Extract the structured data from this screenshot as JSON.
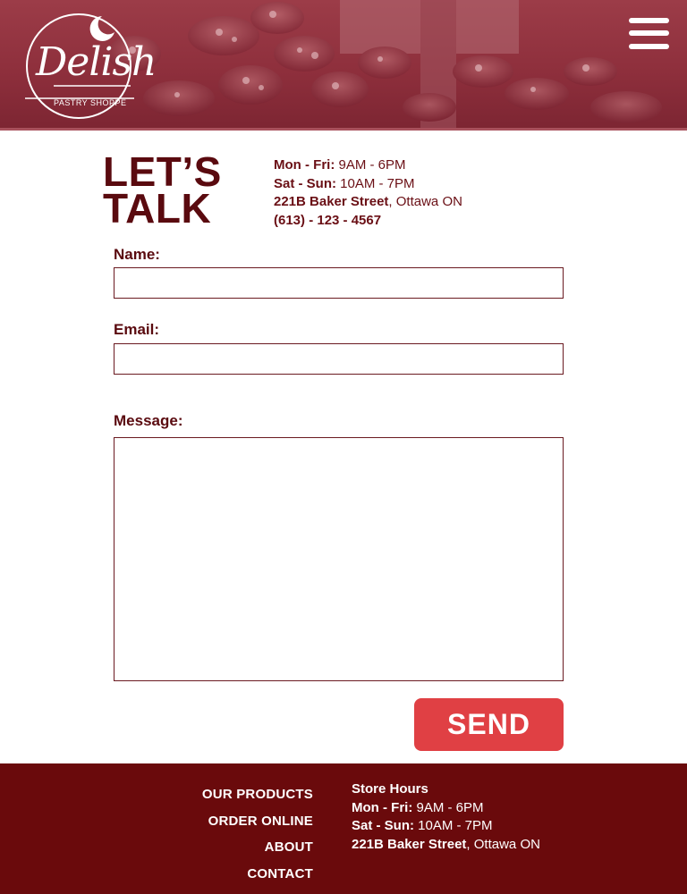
{
  "header": {
    "logo": {
      "name": "Delish",
      "tagline": "PASTRY SHOPPE"
    },
    "menu_icon": "hamburger-menu-icon"
  },
  "contact": {
    "heading_line1": "LET’S",
    "heading_line2": "TALK",
    "weekday_label": "Mon - Fri:",
    "weekday_hours": " 9AM - 6PM",
    "weekend_label": "Sat - Sun:",
    "weekend_hours": " 10AM - 7PM",
    "street": "221B Baker Street",
    "city": ", Ottawa ON",
    "phone_area": "(613)",
    "phone_number": " - 123 - 4567"
  },
  "form": {
    "name_label": "Name:",
    "name_value": "",
    "email_label": "Email:",
    "email_value": "",
    "message_label": "Message:",
    "message_value": "",
    "send_label": "SEND"
  },
  "footer": {
    "nav": [
      "OUR PRODUCTS",
      "ORDER ONLINE",
      "ABOUT",
      "CONTACT"
    ],
    "hours_title": "Store Hours",
    "weekday_label": "Mon - Fri:",
    "weekday_hours": " 9AM - 6PM",
    "weekend_label": "Sat - Sun:",
    "weekend_hours": " 10AM - 7PM",
    "street": "221B Baker Street",
    "city": ", Ottawa ON"
  },
  "colors": {
    "brand_dark": "#5a0a0f",
    "footer_bg": "#6a0a0c",
    "header_tint": "#8e2f3c",
    "button": "#e04044"
  }
}
